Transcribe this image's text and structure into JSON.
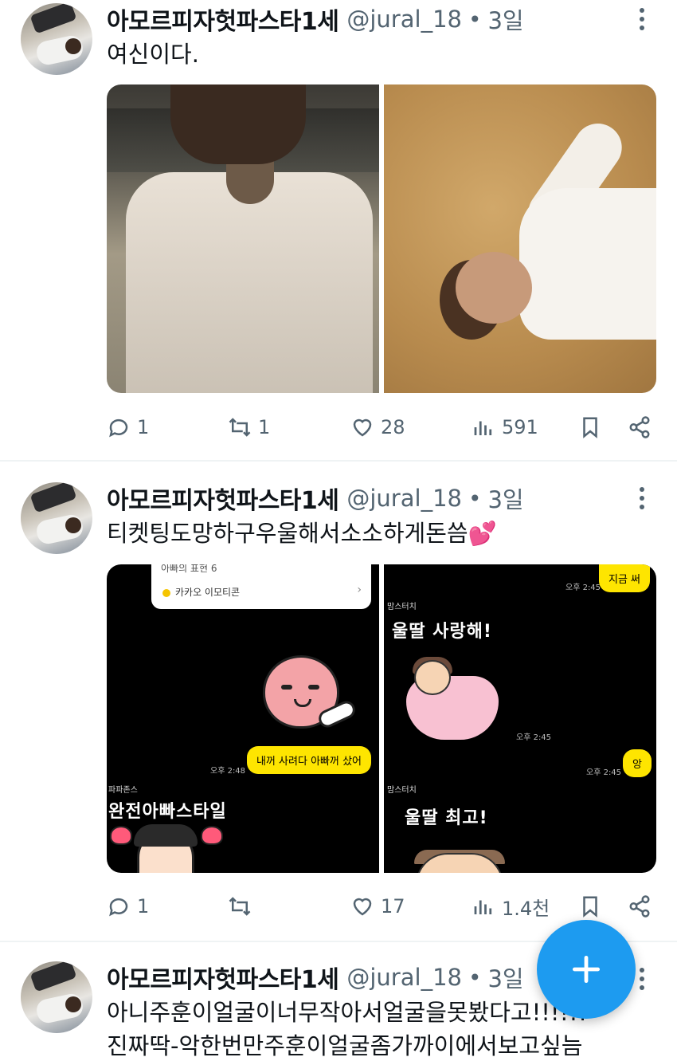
{
  "tweets": [
    {
      "display_name": "아모르피자헛파스타1세",
      "handle": "@jural_18",
      "separator": "•",
      "time": "3일",
      "text": "여신이다.",
      "stats": {
        "replies": "1",
        "retweets": "1",
        "likes": "28",
        "views": "591"
      }
    },
    {
      "display_name": "아모르피자헛파스타1세",
      "handle": "@jural_18",
      "separator": "•",
      "time": "3일",
      "text": "티켓팅도망하구우울해서소소하게돈씀💕",
      "chat_left": {
        "notice_title": "아빠의 표현 6",
        "notice_source": "카카오 이모티콘",
        "bubble": "내꺼 사려다 아빠꺼 샀어",
        "bubble_time": "오후 2:48",
        "sender": "파파존스",
        "sticker_text": "완전아빠스타일"
      },
      "chat_right": {
        "bubble_top": "지금 써",
        "bubble_top_time": "오후 2:45",
        "sender1": "맘스터치",
        "sticker_text1": "울딸 사랑해!",
        "sticker_time1": "오후 2:45",
        "bubble_small": "앙",
        "bubble_small_time": "오후 2:45",
        "sender2": "맘스터치",
        "sticker_text2": "울딸 최고!"
      },
      "stats": {
        "replies": "1",
        "retweets": "",
        "likes": "17",
        "views": "1.4천"
      }
    },
    {
      "display_name": "아모르피자헛파스타1세",
      "handle": "@jural_18",
      "separator": "•",
      "time": "3일",
      "text_line1": "아니주훈이얼굴이너무작아서얼굴을못봤다고!!!!!!",
      "text_line2": "진짜딱-악한번만주훈이얼굴좀가까이에서보고싶늠"
    }
  ],
  "icons": {
    "reply": "speech-bubble-icon",
    "retweet": "retweet-arrows-icon",
    "like": "heart-icon",
    "views": "bar-chart-icon",
    "bookmark": "bookmark-icon",
    "share": "share-nodes-icon",
    "more": "vertical-dots-icon",
    "compose": "plus-icon"
  },
  "colors": {
    "accent": "#1d9bf0",
    "muted_text": "#536471",
    "kakao_bubble": "#fee500"
  }
}
